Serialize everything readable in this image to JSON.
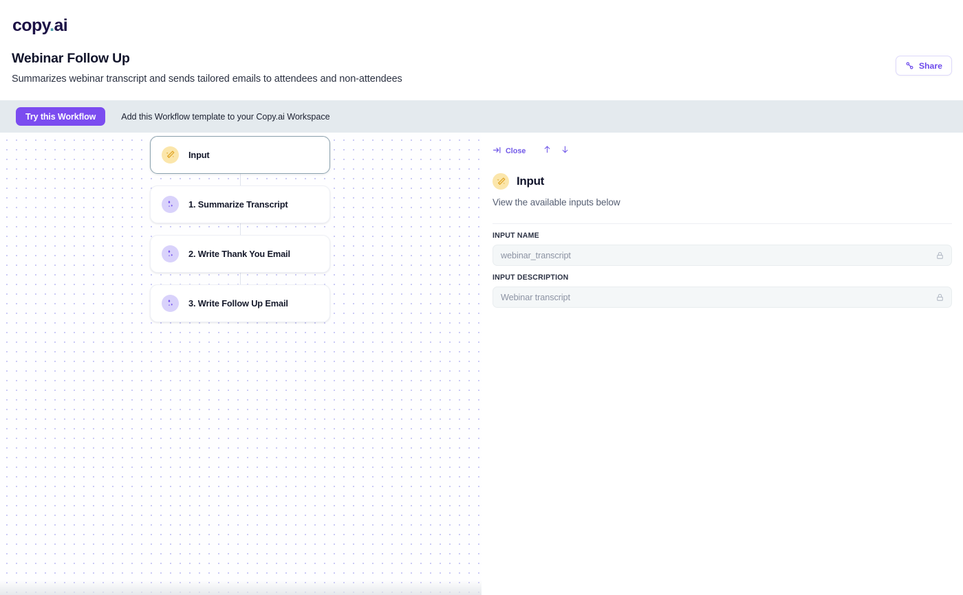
{
  "brand": {
    "logo_text": "copy",
    "logo_dot": ".",
    "logo_suffix": "ai",
    "accent_purple": "#7b4cf0",
    "accent_teal": "#4a9ca8",
    "banner_bg": "#e4eaee"
  },
  "header": {
    "title": "Webinar Follow Up",
    "subtitle": "Summarizes webinar transcript and sends tailored emails to attendees and non-attendees",
    "share_label": "Share",
    "share_icon": "link-icon"
  },
  "banner": {
    "cta_label": "Try this Workflow",
    "text": "Add this Workflow template to your Copy.ai Workspace"
  },
  "canvas": {
    "nodes": [
      {
        "label": "Input",
        "icon": "magic-wand-icon",
        "icon_style": "amber",
        "selected": true
      },
      {
        "label": "1. Summarize Transcript",
        "icon": "sparkles-icon",
        "icon_style": "violet",
        "selected": false
      },
      {
        "label": "2. Write Thank You Email",
        "icon": "sparkles-icon",
        "icon_style": "violet",
        "selected": false
      },
      {
        "label": "3. Write Follow Up Email",
        "icon": "sparkles-icon",
        "icon_style": "violet",
        "selected": false
      }
    ]
  },
  "panel": {
    "toolbar": {
      "close_label": "Close",
      "close_icon": "collapse-right-icon",
      "prev_icon": "arrow-up-icon",
      "next_icon": "arrow-down-icon"
    },
    "title": "Input",
    "title_icon": "magic-wand-icon",
    "description": "View the available inputs below",
    "fields": [
      {
        "label": "INPUT NAME",
        "value": "webinar_transcript",
        "locked": true,
        "lock_icon": "lock-icon"
      },
      {
        "label": "INPUT DESCRIPTION",
        "value": "Webinar transcript",
        "locked": true,
        "lock_icon": "lock-icon"
      }
    ]
  }
}
